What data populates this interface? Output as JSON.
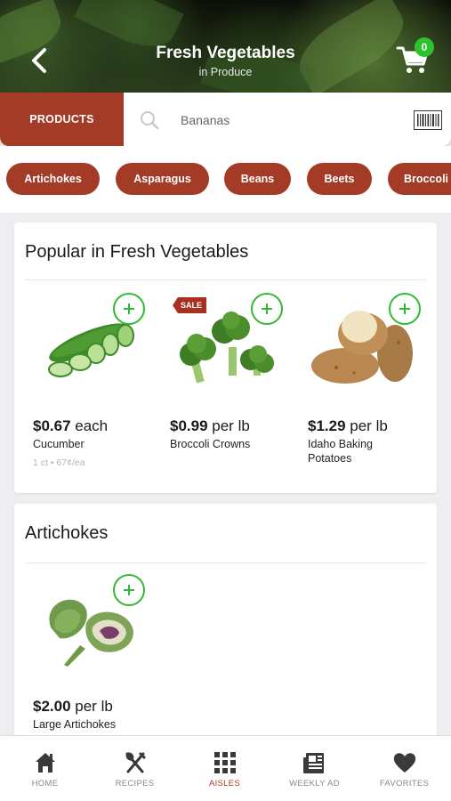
{
  "header": {
    "title": "Fresh Vegetables",
    "subtitle": "in Produce",
    "cart_count": "0"
  },
  "search": {
    "products_tab": "PRODUCTS",
    "placeholder": "Bananas"
  },
  "chips": [
    "Artichokes",
    "Asparagus",
    "Beans",
    "Beets",
    "Broccoli"
  ],
  "popular": {
    "title": "Popular in Fresh Vegetables",
    "products": [
      {
        "price": "$0.67",
        "unit": " each",
        "name": "Cucumber",
        "meta": "1 ct • 67¢/ea"
      },
      {
        "price": "$0.99",
        "unit": " per lb",
        "name": "Broccoli Crowns",
        "badge": "SALE"
      },
      {
        "price": "$1.29",
        "unit": " per lb",
        "name": "Idaho Baking Potatoes"
      }
    ]
  },
  "artichokes": {
    "title": "Artichokes",
    "products": [
      {
        "price": "$2.00",
        "unit": " per lb",
        "name": "Large Artichokes"
      }
    ]
  },
  "nav": [
    {
      "label": "HOME",
      "icon": "home-icon"
    },
    {
      "label": "RECIPES",
      "icon": "utensils-icon"
    },
    {
      "label": "AISLES",
      "icon": "grid-icon",
      "active": true
    },
    {
      "label": "WEEKLY AD",
      "icon": "newspaper-icon"
    },
    {
      "label": "FAVORITES",
      "icon": "heart-icon"
    }
  ],
  "colors": {
    "brand": "#a33b26",
    "add": "#33b833",
    "badge": "#2fc22f"
  }
}
